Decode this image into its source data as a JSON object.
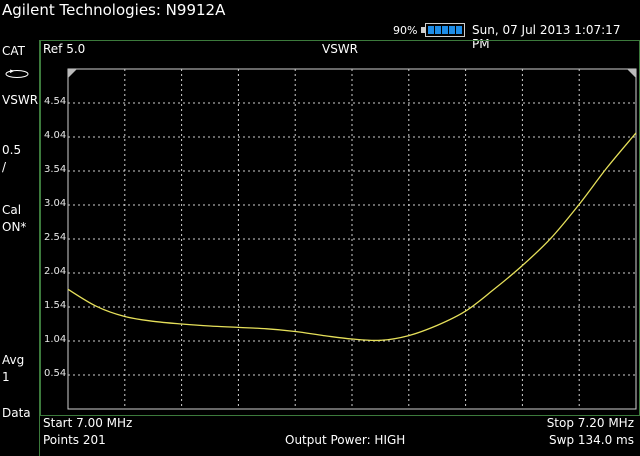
{
  "window": {
    "title": "Agilent Technologies: N9912A"
  },
  "status": {
    "battery_percent": "90%",
    "datetime": "Sun, 07 Jul 2013 1:07:17 PM"
  },
  "left_panel": {
    "mode": "CAT",
    "measurement": "VSWR",
    "scale": "0.5",
    "scale_unit": "/",
    "cal": "Cal",
    "cal_state": "ON*",
    "avg": "Avg",
    "avg_value": "1",
    "data": "Data"
  },
  "plot": {
    "ref_label": "Ref 5.0",
    "title": "VSWR",
    "y_tick_labels": [
      "4.54",
      "4.04",
      "3.54",
      "3.04",
      "2.54",
      "2.04",
      "1.54",
      "1.04",
      "0.54"
    ]
  },
  "footer": {
    "start": "Start 7.00 MHz",
    "stop": "Stop 7.20 MHz",
    "points": "Points 201",
    "output_power": "Output Power: HIGH",
    "sweep": "Swp 134.0 ms"
  },
  "colors": {
    "trace": "#e6e05a",
    "grid": "#d0d0d0",
    "border": "#3c7a3c",
    "battery": "#1e8de8"
  },
  "chart_data": {
    "type": "line",
    "title": "VSWR",
    "xlabel": "",
    "ylabel": "",
    "xlim": [
      7.0,
      7.2
    ],
    "ylim": [
      0.04,
      5.04
    ],
    "x_unit": "MHz",
    "series": [
      {
        "x": [
          7.0,
          7.01,
          7.02,
          7.03,
          7.04,
          7.05,
          7.06,
          7.07,
          7.08,
          7.09,
          7.1,
          7.11,
          7.12,
          7.13,
          7.14,
          7.15,
          7.16,
          7.17,
          7.18,
          7.19,
          7.2
        ],
        "values": [
          1.8,
          1.55,
          1.4,
          1.33,
          1.29,
          1.26,
          1.24,
          1.22,
          1.18,
          1.12,
          1.07,
          1.05,
          1.12,
          1.27,
          1.48,
          1.8,
          2.15,
          2.55,
          3.05,
          3.6,
          4.1
        ]
      }
    ]
  }
}
